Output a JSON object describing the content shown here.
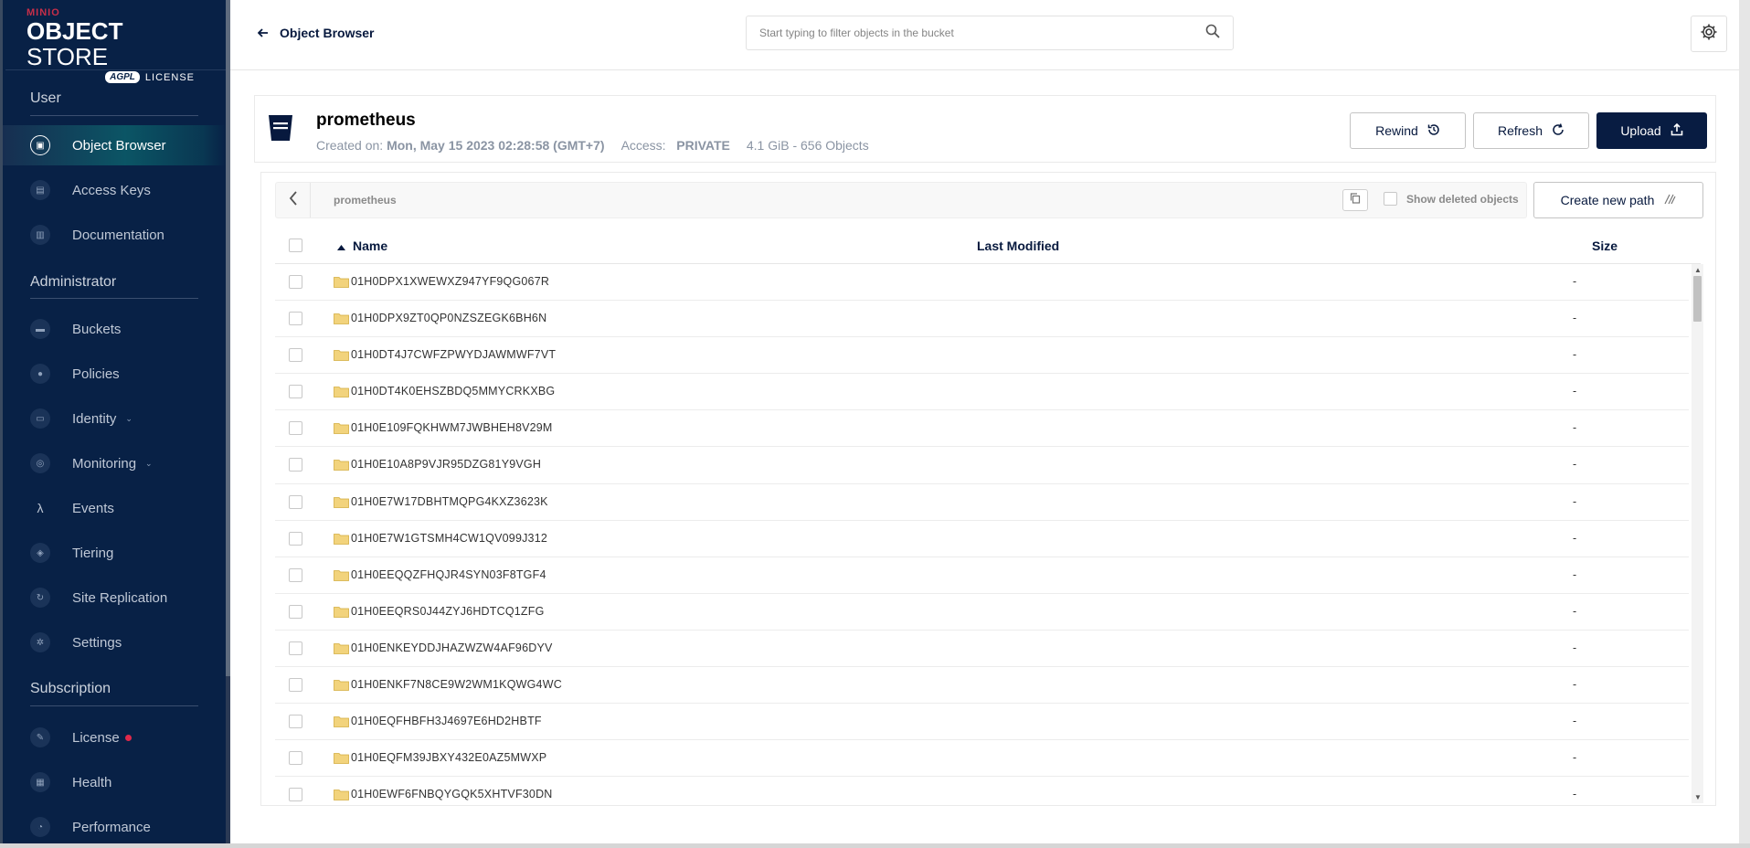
{
  "logo": {
    "brand": "MINIO",
    "product_bold": "OBJECT",
    "product_rest": " STORE",
    "agpl": "AGPL",
    "license": "LICENSE"
  },
  "sidebar": {
    "sections": [
      {
        "title": "User"
      },
      {
        "title": "Administrator"
      },
      {
        "title": "Subscription"
      }
    ],
    "items": [
      {
        "label": "Object Browser",
        "icon": "object-browser-icon"
      },
      {
        "label": "Access Keys",
        "icon": "access-keys-icon"
      },
      {
        "label": "Documentation",
        "icon": "documentation-icon"
      },
      {
        "label": "Buckets",
        "icon": "buckets-icon"
      },
      {
        "label": "Policies",
        "icon": "policies-icon"
      },
      {
        "label": "Identity",
        "icon": "identity-icon"
      },
      {
        "label": "Monitoring",
        "icon": "monitoring-icon"
      },
      {
        "label": "Events",
        "icon": "lambda-icon"
      },
      {
        "label": "Tiering",
        "icon": "tiering-icon"
      },
      {
        "label": "Site Replication",
        "icon": "site-replication-icon"
      },
      {
        "label": "Settings",
        "icon": "settings-icon"
      },
      {
        "label": "License",
        "icon": "license-icon"
      },
      {
        "label": "Health",
        "icon": "health-icon"
      },
      {
        "label": "Performance",
        "icon": "performance-icon"
      }
    ]
  },
  "topbar": {
    "back_label": "Object Browser",
    "search_placeholder": "Start typing to filter objects in the bucket"
  },
  "bucket": {
    "name": "prometheus",
    "created_label": "Created on:",
    "created_value": "Mon, May 15 2023 02:28:58 (GMT+7)",
    "access_label": "Access:",
    "access_value": "PRIVATE",
    "usage": "4.1 GiB - 656 Objects",
    "rewind_label": "Rewind",
    "refresh_label": "Refresh",
    "upload_label": "Upload"
  },
  "browser": {
    "path": "prometheus",
    "show_deleted_label": "Show deleted objects",
    "create_path_label": "Create new path",
    "columns": {
      "name": "Name",
      "modified": "Last Modified",
      "size": "Size"
    },
    "rows": [
      {
        "name": "01H0DPX1XWEWXZ947YF9QG067R",
        "size": "-"
      },
      {
        "name": "01H0DPX9ZT0QP0NZSZEGK6BH6N",
        "size": "-"
      },
      {
        "name": "01H0DT4J7CWFZPWYDJAWMWF7VT",
        "size": "-"
      },
      {
        "name": "01H0DT4K0EHSZBDQ5MMYCRKXBG",
        "size": "-"
      },
      {
        "name": "01H0E109FQKHWM7JWBHEH8V29M",
        "size": "-"
      },
      {
        "name": "01H0E10A8P9VJR95DZG81Y9VGH",
        "size": "-"
      },
      {
        "name": "01H0E7W17DBHTMQPG4KXZ3623K",
        "size": "-"
      },
      {
        "name": "01H0E7W1GTSMH4CW1QV099J312",
        "size": "-"
      },
      {
        "name": "01H0EEQQZFHQJR4SYN03F8TGF4",
        "size": "-"
      },
      {
        "name": "01H0EEQRS0J44ZYJ6HDTCQ1ZFG",
        "size": "-"
      },
      {
        "name": "01H0ENKEYDDJHAZWZW4AF96DYV",
        "size": "-"
      },
      {
        "name": "01H0ENKF7N8CE9W2WM1KQWG4WC",
        "size": "-"
      },
      {
        "name": "01H0EQFHBFH3J4697E6HD2HBTF",
        "size": "-"
      },
      {
        "name": "01H0EQFM39JBXY432E0AZ5MWXP",
        "size": "-"
      },
      {
        "name": "01H0EWF6FNBQYGQK5XHTVF30DN",
        "size": "-"
      }
    ]
  }
}
